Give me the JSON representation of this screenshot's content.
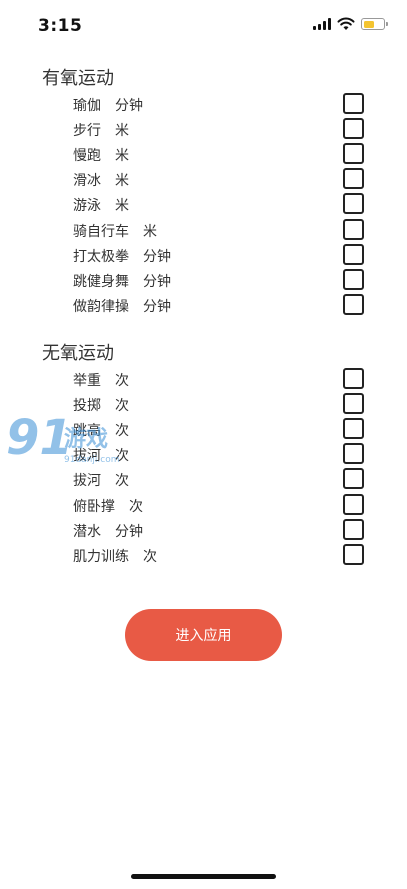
{
  "status_bar": {
    "time": "3:15",
    "battery_level": 0.55,
    "battery_color": "#f4c430",
    "icons": [
      "signal-icon",
      "wifi-icon",
      "battery-icon"
    ]
  },
  "sections": [
    {
      "title": "有氧运动",
      "items": [
        {
          "name": "瑜伽",
          "unit": "分钟",
          "checked": false
        },
        {
          "name": "步行",
          "unit": "米",
          "checked": false
        },
        {
          "name": "慢跑",
          "unit": "米",
          "checked": false
        },
        {
          "name": "滑冰",
          "unit": "米",
          "checked": false
        },
        {
          "name": "游泳",
          "unit": "米",
          "checked": false
        },
        {
          "name": "骑自行车",
          "unit": "米",
          "checked": false
        },
        {
          "name": "打太极拳",
          "unit": "分钟",
          "checked": false
        },
        {
          "name": "跳健身舞",
          "unit": "分钟",
          "checked": false
        },
        {
          "name": "做韵律操",
          "unit": "分钟",
          "checked": false
        }
      ]
    },
    {
      "title": "无氧运动",
      "items": [
        {
          "name": "举重",
          "unit": "次",
          "checked": false
        },
        {
          "name": "投掷",
          "unit": "次",
          "checked": false
        },
        {
          "name": "跳高",
          "unit": "次",
          "checked": false
        },
        {
          "name": "拔河",
          "unit": "次",
          "checked": false
        },
        {
          "name": "拔河",
          "unit": "次",
          "checked": false
        },
        {
          "name": "俯卧撑",
          "unit": "次",
          "checked": false
        },
        {
          "name": "潜水",
          "unit": "分钟",
          "checked": false
        },
        {
          "name": "肌力训练",
          "unit": "次",
          "checked": false
        }
      ]
    }
  ],
  "enter_button": {
    "label": "进入应用",
    "color": "#e85a45"
  },
  "watermark": {
    "logo_text": "91游戏",
    "url_text": "91danji.com"
  }
}
